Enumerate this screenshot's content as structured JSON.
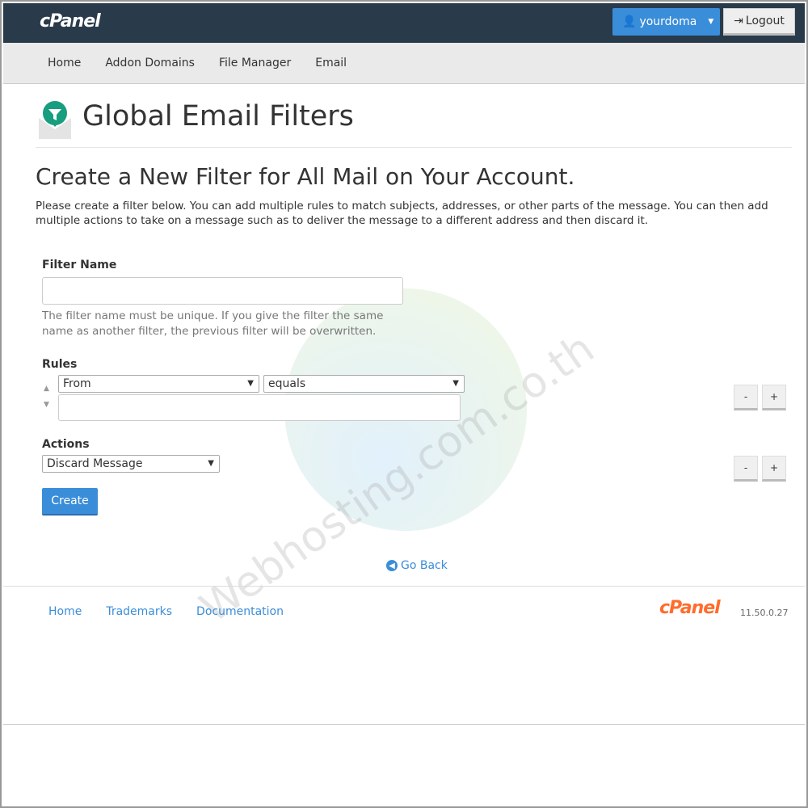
{
  "header": {
    "logo": "cPanel",
    "user": "yourdoma",
    "logout": "Logout"
  },
  "nav": [
    "Home",
    "Addon Domains",
    "File Manager",
    "Email"
  ],
  "page": {
    "title": "Global Email Filters",
    "heading": "Create a New Filter for All Mail on Your Account.",
    "description": "Please create a filter below. You can add multiple rules to match subjects, addresses, or other parts of the message. You can then add multiple actions to take on a message such as to deliver the message to a different address and then discard it."
  },
  "form": {
    "filter_name_label": "Filter Name",
    "filter_name_value": "",
    "filter_name_help": "The filter name must be unique. If you give the filter the same name as another filter, the previous filter will be overwritten.",
    "rules_label": "Rules",
    "rule_field": "From",
    "rule_operator": "equals",
    "rule_value": "",
    "actions_label": "Actions",
    "action": "Discard Message",
    "minus": "-",
    "plus": "+",
    "create": "Create"
  },
  "go_back": "Go Back",
  "footer": {
    "links": [
      "Home",
      "Trademarks",
      "Documentation"
    ],
    "logo": "cPanel",
    "version": "11.50.0.27"
  },
  "watermark": "Webhosting.com.co.th",
  "colors": {
    "accent": "#3a8dd8",
    "topbar": "#293a4a",
    "brand": "#ff6c2c"
  }
}
